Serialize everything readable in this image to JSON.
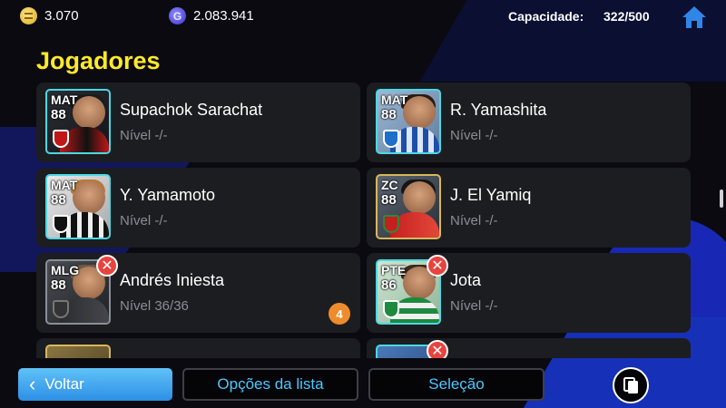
{
  "header": {
    "coins": "3.070",
    "gp": "2.083.941",
    "gp_symbol": "G",
    "capacity_label": "Capacidade:",
    "capacity_value": "322/500",
    "home_icon": "home-icon"
  },
  "section_title": "Jogadores",
  "players": [
    {
      "name": "Supachok Sarachat",
      "level": "Nível -/-",
      "position": "MAT",
      "rating": "88"
    },
    {
      "name": "R. Yamashita",
      "level": "Nível -/-",
      "position": "MAT",
      "rating": "88"
    },
    {
      "name": "Y. Yamamoto",
      "level": "Nível -/-",
      "position": "MAT",
      "rating": "88"
    },
    {
      "name": "J. El Yamiq",
      "level": "Nível -/-",
      "position": "ZC",
      "rating": "88"
    },
    {
      "name": "Andrés Iniesta",
      "level": "Nível 36/36",
      "position": "MLG",
      "rating": "88",
      "removable": true,
      "count": "4"
    },
    {
      "name": "Jota",
      "level": "Nível -/-",
      "position": "PTE",
      "rating": "86",
      "removable": true
    }
  ],
  "footer": {
    "back_label": "Voltar",
    "options_label": "Opções da lista",
    "selection_label": "Seleção"
  },
  "colors": {
    "accent_title": "#ffea2b",
    "button_blue": "#2e8fe6",
    "button_text": "#4dc7ff",
    "remove_badge": "#e8443f",
    "count_badge": "#ee8c2c"
  }
}
